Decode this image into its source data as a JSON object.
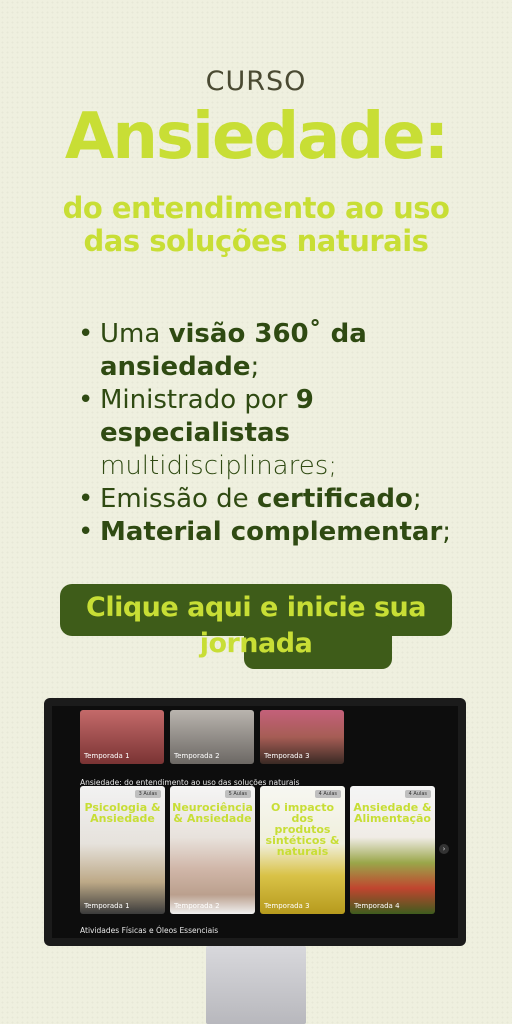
{
  "header": {
    "eyebrow": "CURSO",
    "title": "Ansiedade:",
    "subtitle_line1": "do entendimento ao uso",
    "subtitle_line2": "das soluções naturais"
  },
  "bullets": [
    {
      "pre": "Uma ",
      "bold": "visão 360˚ da ansiedade",
      "post": ";"
    },
    {
      "pre": "Ministrado por ",
      "bold": "9 especialistas",
      "post": " multidisciplinares;"
    },
    {
      "pre": "Emissão de ",
      "bold": "certificado",
      "post": ";"
    },
    {
      "pre": "",
      "bold": "Material complementar",
      "post": ";"
    }
  ],
  "cta": {
    "label_line1": "Clique aqui e inicie sua",
    "label_line2": "jornada"
  },
  "screen": {
    "top_row": [
      "Temporada 1",
      "Temporada 2",
      "Temporada 3"
    ],
    "section_title": "Ansiedade: do entendimento ao uso das soluções naturais",
    "cards": [
      {
        "title": "Psicologia & Ansiedade",
        "badge": "3 Aulas",
        "season": "Temporada 1"
      },
      {
        "title": "Neurociência & Ansiedade",
        "badge": "5 Aulas",
        "season": "Temporada 2"
      },
      {
        "title": "O impacto dos produtos sintéticos & naturais",
        "badge": "4 Aulas",
        "season": "Temporada 3"
      },
      {
        "title": "Ansiedade & Alimentação",
        "badge": "4 Aulas",
        "season": "Temporada 4"
      }
    ],
    "next_section_title": "Atividades Físicas e Óleos Essenciais"
  },
  "colors": {
    "background": "#eff0df",
    "lime": "#c8de35",
    "dark_green": "#3e5c19",
    "text_green": "#2f4a12"
  }
}
